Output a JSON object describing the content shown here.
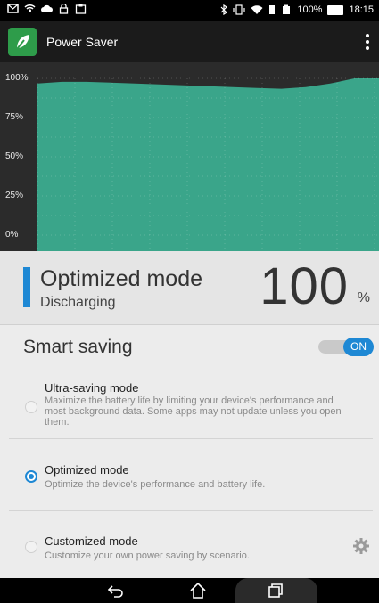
{
  "status_bar": {
    "battery_percent": "100%",
    "time": "18:15",
    "left_icons": [
      "message-icon",
      "wifi-hotspot-icon",
      "cloud-icon",
      "lock-icon",
      "screenshot-icon"
    ],
    "right_icons": [
      "bluetooth-icon",
      "vibrate-icon",
      "wifi-icon",
      "sim-icon",
      "battery-icon"
    ]
  },
  "app_bar": {
    "title": "Power Saver",
    "logo": "leaf-icon",
    "menu": "overflow-menu-icon"
  },
  "chart_data": {
    "type": "area",
    "y_ticks": [
      "100%",
      "75%",
      "50%",
      "25%",
      "0%"
    ],
    "ylim": [
      0,
      100
    ],
    "values": [
      97,
      98,
      98,
      97.5,
      97,
      96.5,
      96,
      95.5,
      95,
      94.5,
      94,
      95,
      97,
      100,
      100
    ],
    "fill_color": "#3aa58a",
    "background_color": "#2b2b2b",
    "grid": true
  },
  "summary": {
    "mode_title": "Optimized mode",
    "mode_state": "Discharging",
    "percent": "100",
    "percent_unit": "%",
    "accent_color": "#1e88d4"
  },
  "smart_saving": {
    "title": "Smart saving",
    "toggle_label": "ON",
    "toggle_on": true
  },
  "options": [
    {
      "name": "Ultra-saving mode",
      "desc": "Maximize the battery life by limiting your device's performance and most background data. Some apps may not update unless you open them.",
      "selected": false
    },
    {
      "name": "Optimized mode",
      "desc": "Optimize the device's performance and battery life.",
      "selected": true
    },
    {
      "name": "Customized mode",
      "desc": "Customize your own power saving by scenario.",
      "selected": false
    }
  ],
  "nav_bar": {
    "buttons": [
      "back-icon",
      "home-icon",
      "recent-apps-icon"
    ]
  }
}
